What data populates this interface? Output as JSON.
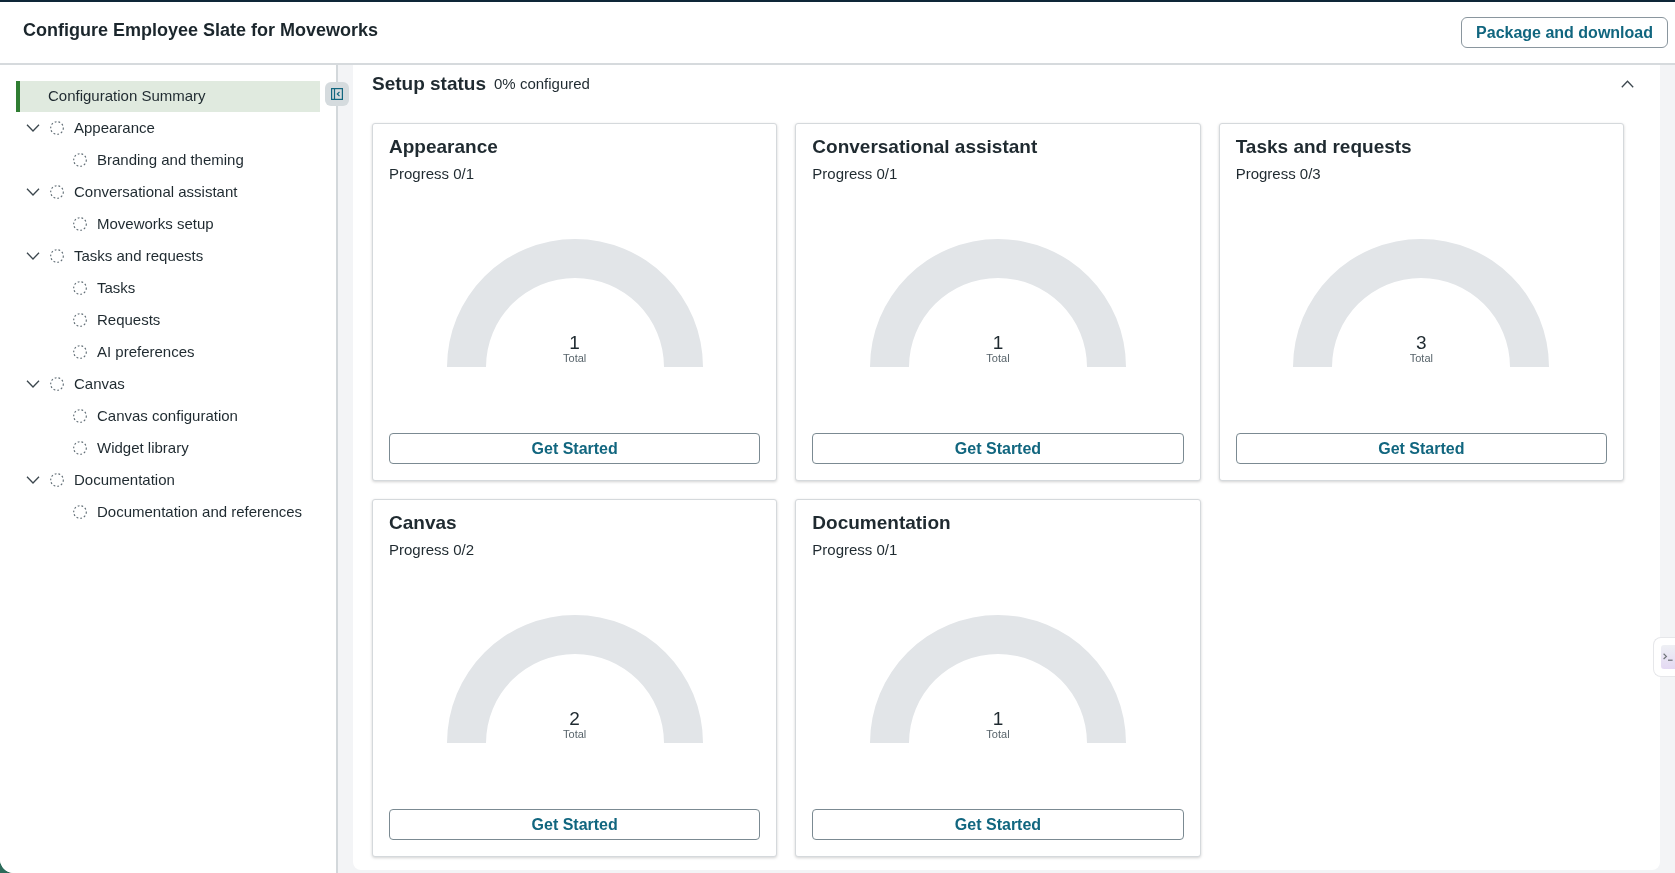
{
  "header": {
    "title": "Configure Employee Slate for Moveworks",
    "action_button": "Package and download"
  },
  "sidebar": {
    "items": [
      {
        "kind": "summary",
        "label": "Configuration Summary",
        "selected": true
      },
      {
        "kind": "group",
        "label": "Appearance",
        "selected": false,
        "expanded": true,
        "complete": false,
        "children": [
          {
            "label": "Branding and theming",
            "selected": false,
            "complete": false
          }
        ]
      },
      {
        "kind": "group",
        "label": "Conversational assistant",
        "selected": false,
        "expanded": true,
        "complete": false,
        "children": [
          {
            "label": "Moveworks setup",
            "selected": false,
            "complete": false
          }
        ]
      },
      {
        "kind": "group",
        "label": "Tasks and requests",
        "selected": false,
        "expanded": true,
        "complete": false,
        "children": [
          {
            "label": "Tasks",
            "selected": false,
            "complete": false
          },
          {
            "label": "Requests",
            "selected": false,
            "complete": false
          },
          {
            "label": "AI preferences",
            "selected": false,
            "complete": false
          }
        ]
      },
      {
        "kind": "group",
        "label": "Canvas",
        "selected": false,
        "expanded": true,
        "complete": false,
        "children": [
          {
            "label": "Canvas configuration",
            "selected": false,
            "complete": false
          },
          {
            "label": "Widget library",
            "selected": false,
            "complete": false
          }
        ]
      },
      {
        "kind": "group",
        "label": "Documentation",
        "selected": false,
        "expanded": true,
        "complete": false,
        "children": [
          {
            "label": "Documentation and references",
            "selected": false,
            "complete": false
          }
        ]
      }
    ]
  },
  "setup_status": {
    "title": "Setup status",
    "summary": "0% configured",
    "expanded": true,
    "cards": [
      {
        "title": "Appearance",
        "progress": "Progress 0/1",
        "gauge": {
          "total": "1",
          "total_label": "Total"
        },
        "button": "Get Started"
      },
      {
        "title": "Conversational assistant",
        "progress": "Progress 0/1",
        "gauge": {
          "total": "1",
          "total_label": "Total"
        },
        "button": "Get Started"
      },
      {
        "title": "Tasks and requests",
        "progress": "Progress 0/3",
        "gauge": {
          "total": "3",
          "total_label": "Total"
        },
        "button": "Get Started"
      },
      {
        "title": "Canvas",
        "progress": "Progress 0/2",
        "gauge": {
          "total": "2",
          "total_label": "Total"
        },
        "button": "Get Started"
      },
      {
        "title": "Documentation",
        "progress": "Progress 0/1",
        "gauge": {
          "total": "1",
          "total_label": "Total"
        },
        "button": "Get Started"
      }
    ]
  }
}
